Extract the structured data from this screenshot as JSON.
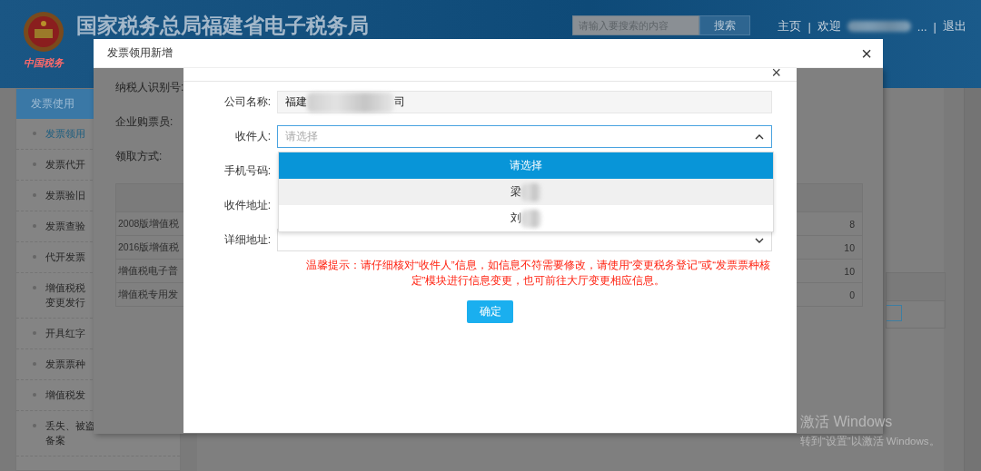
{
  "header": {
    "emblem_text": "中国税务",
    "title": "国家税务总局福建省电子税务局",
    "search": {
      "placeholder": "请输入要搜索的内容"
    },
    "search_button": "搜索",
    "nav": [
      {
        "kind": "link",
        "text": "主页"
      },
      {
        "kind": "sep",
        "text": "|"
      },
      {
        "kind": "user",
        "text": "欢迎"
      },
      {
        "kind": "link",
        "text": "..."
      },
      {
        "kind": "sep",
        "text": "|"
      },
      {
        "kind": "link",
        "text": "退出"
      }
    ]
  },
  "sidebar": {
    "section": "发票使用",
    "items": [
      {
        "lines": [
          "发票领用"
        ],
        "selected": true
      },
      {
        "lines": [
          "发票代开"
        ],
        "selected": false
      },
      {
        "lines": [
          "发票验旧"
        ],
        "selected": false
      },
      {
        "lines": [
          "发票查验"
        ],
        "selected": false
      },
      {
        "lines": [
          "代开发票"
        ],
        "selected": false
      },
      {
        "lines": [
          "增值税税",
          "变更发行"
        ],
        "selected": false
      },
      {
        "lines": [
          "开具红字"
        ],
        "selected": false
      },
      {
        "lines": [
          "发票票种"
        ],
        "selected": false
      },
      {
        "lines": [
          "增值税发"
        ],
        "selected": false
      },
      {
        "lines": [
          "丢失、被盗",
          "备案"
        ],
        "selected": false
      }
    ]
  },
  "outer_dialog": {
    "title": "发票领用新增",
    "close": "×",
    "fields": [
      "纳税人识别号:",
      "企业购票员:",
      "领取方式:"
    ],
    "table": {
      "rows": [
        {
          "name": "2008版增值税",
          "count": "8"
        },
        {
          "name": "2016版增值税",
          "count": "10"
        },
        {
          "name": "增值税电子普",
          "count": "10"
        },
        {
          "name": "增值税专用发",
          "count": "0"
        }
      ]
    }
  },
  "inner_dialog": {
    "close": "×",
    "fields": [
      {
        "label": "公司名称:",
        "kind": "readonly",
        "value_start": "福建",
        "value_end": "司"
      },
      {
        "label": "收件人:",
        "kind": "select",
        "placeholder": "请选择",
        "expanded": true
      },
      {
        "label": "手机号码:",
        "kind": "covered"
      },
      {
        "label": "收件地址:",
        "kind": "covered"
      },
      {
        "label": "详细地址:",
        "kind": "select",
        "expanded": false
      }
    ],
    "options": [
      {
        "text": "请选择",
        "selected": true,
        "hovered": false,
        "masked": false
      },
      {
        "text": "梁",
        "selected": false,
        "hovered": true,
        "masked": true
      },
      {
        "text": "刘",
        "selected": false,
        "hovered": false,
        "masked": true
      }
    ],
    "notice": "温馨提示：请仔细核对“收件人”信息，如信息不符需要修改，请使用“变更税务登记”或“发票票种核定”模块进行信息变更，也可前往大厅变更相应信息。",
    "confirm": "确定"
  },
  "os_notice": {
    "title": "激活 Windows",
    "text": "转到“设置”以激活 Windows。"
  }
}
